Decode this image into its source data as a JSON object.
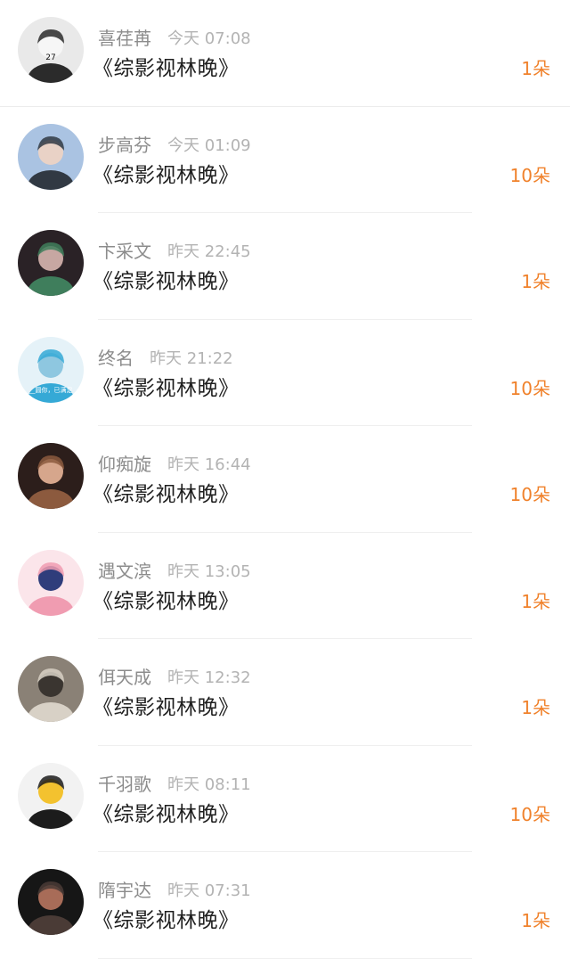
{
  "items": [
    {
      "name": "喜荏苒",
      "time": "今天 07:08",
      "title": "《综影视林晚》",
      "gift": "1朵",
      "avatar_palette": [
        "#e9e9e9",
        "#2b2b2b",
        "#f6f6f6"
      ],
      "avatar_text": "27"
    },
    {
      "name": "步高芬",
      "time": "今天 01:09",
      "title": "《综影视林晚》",
      "gift": "10朵",
      "avatar_palette": [
        "#aac3e2",
        "#313943",
        "#e9d2c6"
      ]
    },
    {
      "name": "卞采文",
      "time": "昨天 22:45",
      "title": "《综影视林晚》",
      "gift": "1朵",
      "avatar_palette": [
        "#2a2226",
        "#3f7e5c",
        "#c7a7a2"
      ]
    },
    {
      "name": "终名",
      "time": "昨天 21:22",
      "title": "《综影视林晚》",
      "gift": "10朵",
      "avatar_palette": [
        "#e5f2f8",
        "#35a9d6",
        "#8ec7e0"
      ],
      "avatar_text": "__圆你，已满足"
    },
    {
      "name": "仰痴旋",
      "time": "昨天 16:44",
      "title": "《综影视林晚》",
      "gift": "10朵",
      "avatar_palette": [
        "#2c1e1b",
        "#8c5a3e",
        "#d6a68c"
      ]
    },
    {
      "name": "遇文滨",
      "time": "昨天 13:05",
      "title": "《综影视林晚》",
      "gift": "1朵",
      "avatar_palette": [
        "#fbe5ea",
        "#f09cb1",
        "#2f3d7b"
      ]
    },
    {
      "name": "佴天成",
      "time": "昨天 12:32",
      "title": "《综影视林晚》",
      "gift": "1朵",
      "avatar_palette": [
        "#8a8176",
        "#d8d1c6",
        "#3a3530"
      ]
    },
    {
      "name": "千羽歌",
      "time": "昨天 08:11",
      "title": "《综影视林晚》",
      "gift": "10朵",
      "avatar_palette": [
        "#f2f2f2",
        "#1c1c1c",
        "#f3c22f"
      ]
    },
    {
      "name": "隋宇达",
      "time": "昨天 07:31",
      "title": "《综影视林晚》",
      "gift": "1朵",
      "avatar_palette": [
        "#161616",
        "#4a3b36",
        "#a86c58"
      ]
    }
  ]
}
